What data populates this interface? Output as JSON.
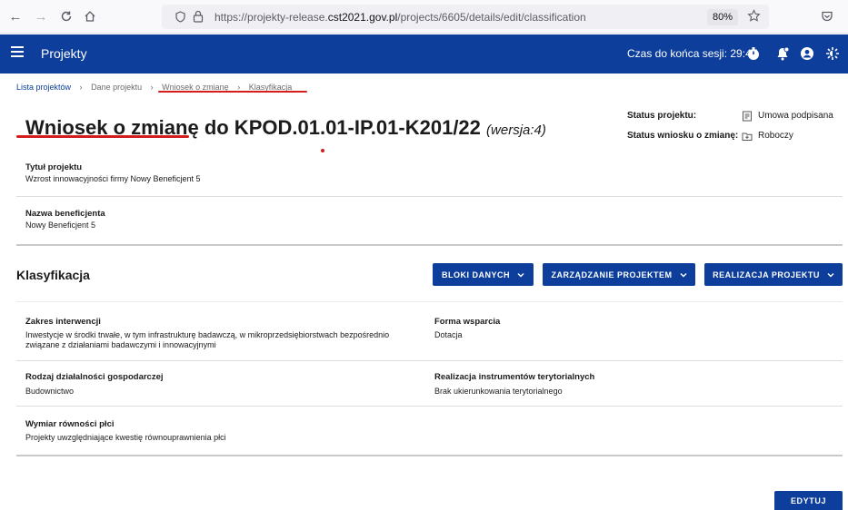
{
  "browser": {
    "url_prefix": "https://projekty-release.",
    "url_domain": "cst2021.gov.pl",
    "url_path": "/projects/6605/details/edit/classification",
    "zoom": "80%"
  },
  "header": {
    "title": "Projekty",
    "session_text": "Czas do końca sesji: 29:47"
  },
  "breadcrumb": {
    "items": [
      "Lista projektów",
      "Dane projektu",
      "Wniosek o zmianę",
      "Klasyfikacja"
    ]
  },
  "title": {
    "main": "Wniosek o zmianę do KPOD.01.01-IP.01-K201/22",
    "version": "(wersja:4)"
  },
  "status": {
    "project_label": "Status projektu:",
    "project_value": "Umowa podpisana",
    "request_label": "Status wniosku o zmianę:",
    "request_value": "Roboczy"
  },
  "project": {
    "title_label": "Tytuł projektu",
    "title_value": "Wzrost innowacyjności firmy Nowy Beneficjent 5",
    "beneficiary_label": "Nazwa beneficjenta",
    "beneficiary_value": "Nowy Beneficjent 5"
  },
  "section": {
    "title": "Klasyfikacja",
    "buttons": [
      "BLOKI DANYCH",
      "ZARZĄDZANIE PROJEKTEM",
      "REALIZACJA PROJEKTU"
    ]
  },
  "classification": {
    "intervention_label": "Zakres interwencji",
    "intervention_value": "Inwestycje w środki trwałe, w tym infrastrukturę badawczą, w mikroprzedsiębiorstwach bezpośrednio związane z działaniami badawczymi i innowacyjnymi",
    "support_label": "Forma wsparcia",
    "support_value": "Dotacja",
    "activity_label": "Rodzaj działalności gospodarczej",
    "activity_value": "Budownictwo",
    "territorial_label": "Realizacja instrumentów terytorialnych",
    "territorial_value": "Brak ukierunkowania terytorialnego",
    "gender_label": "Wymiar równości płci",
    "gender_value": "Projekty uwzględniające kwestię równouprawnienia płci"
  },
  "actions": {
    "edit_label": "EDYTUJ"
  },
  "colors": {
    "primary": "#0d3e9c",
    "annotation": "#d21e1e"
  }
}
